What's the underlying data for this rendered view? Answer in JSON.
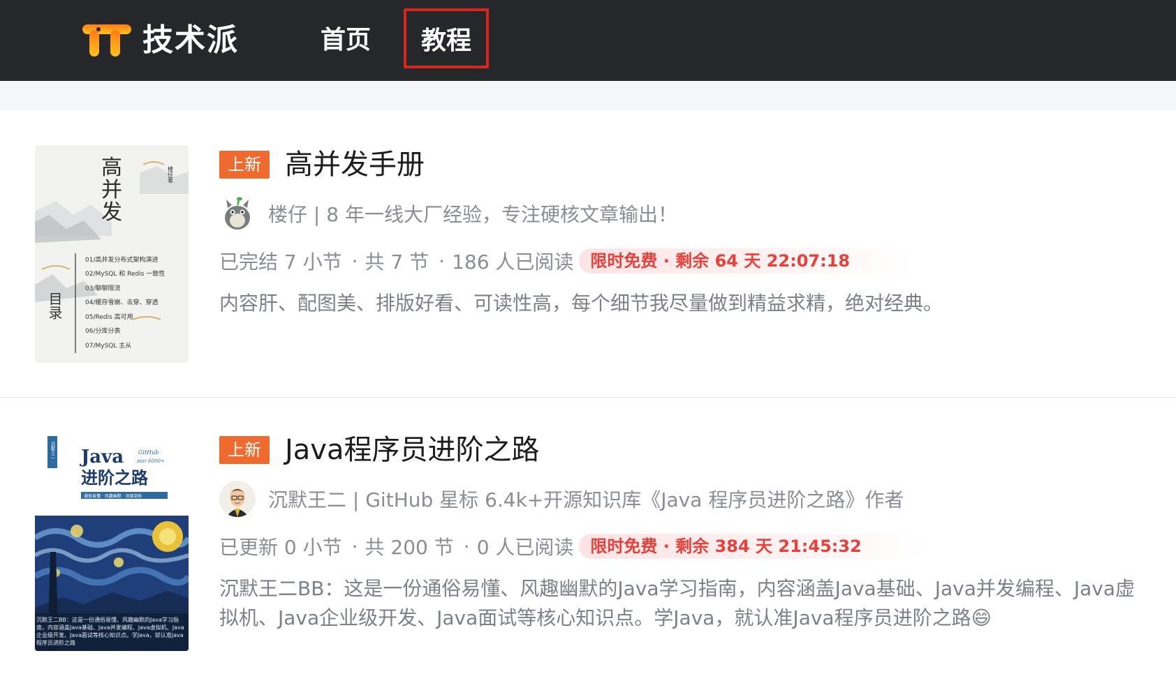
{
  "header": {
    "brand": "技术派",
    "nav": [
      {
        "label": "首页"
      },
      {
        "label": "教程"
      }
    ],
    "active_nav": "教程",
    "highlight_color": "#d8261f",
    "bg_color": "#25272b"
  },
  "courses": [
    {
      "badge": "上新",
      "title": "高并发手册",
      "author": "楼仔 | 8 年一线大厂经验，专注硬核文章输出！",
      "stats": {
        "progress": "已完结 7 小节",
        "total": "共 7 节",
        "readers": "186 人已阅读"
      },
      "promo": "限时免费 · 剩余 64 天 22:07:18",
      "description": "内容肝、配图美、排版好看、可读性高，每个细节我尽量做到精益求精，绝对经典。",
      "cover": {
        "title_chars": [
          "高",
          "并",
          "发"
        ],
        "side_text": "楼仔著",
        "toc_label": "目录",
        "toc": [
          "01/高并发分布式架构演进",
          "02/MySQL 和 Redis 一致性",
          "03/聊聊限流",
          "04/缓存雪崩、击穿、穿透",
          "05/Redis 高可用",
          "06/分库分表",
          "07/MySQL 主从"
        ]
      }
    },
    {
      "badge": "上新",
      "title": "Java程序员进阶之路",
      "author": "沉默王二 | GitHub 星标 6.4k+开源知识库《Java 程序员进阶之路》作者",
      "stats": {
        "progress": "已更新 0 小节",
        "total": "共 200 节",
        "readers": "0 人已阅读"
      },
      "promo": "限时免费 · 剩余 384 天 21:45:32",
      "description": "沉默王二BB：这是一份通俗易懂、风趣幽默的Java学习指南，内容涵盖Java基础、Java并发编程、Java虚拟机、Java企业级开发、Java面试等核心知识点。学Java，就认准Java程序员进阶之路😄",
      "cover": {
        "line1": "Java",
        "github": "GitHub",
        "stars": "star 6000+",
        "line2": "进阶之路",
        "tagline": "通俗易懂 · 风趣幽默 · 深度剖析",
        "side_label": "沉默王二",
        "bottom_text": "沉默王二BB：这是一份通俗易懂、风趣幽默的Java学习指南，内容涵盖Java基础、Java并发编程、Java虚拟机、Java企业级开发、Java面试等核心知识点。学Java，就认准Java程序员进阶之路"
      }
    }
  ]
}
